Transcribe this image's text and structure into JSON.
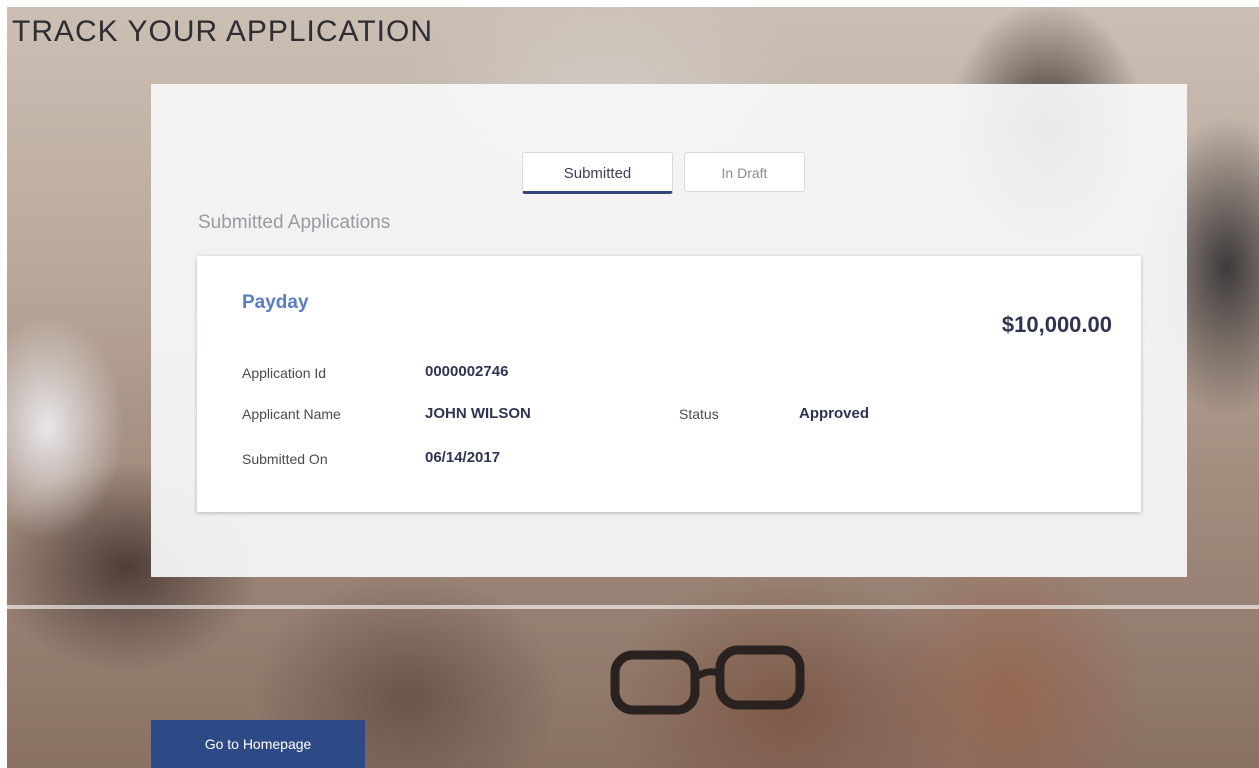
{
  "page": {
    "title": "TRACK YOUR APPLICATION"
  },
  "tabs": [
    {
      "label": "Submitted",
      "active": true
    },
    {
      "label": "In Draft",
      "active": false
    }
  ],
  "section": {
    "title": "Submitted Applications"
  },
  "application": {
    "product": "Payday",
    "amount": "$10,000.00",
    "fields": {
      "application_id_label": "Application Id",
      "application_id_value": "0000002746",
      "applicant_name_label": "Applicant Name",
      "applicant_name_value": "JOHN WILSON",
      "submitted_on_label": "Submitted On",
      "submitted_on_value": "06/14/2017",
      "status_label": "Status",
      "status_value": "Approved"
    }
  },
  "footer": {
    "home_button_label": "Go to Homepage"
  },
  "colors": {
    "accent": "#2e4a86",
    "product_link": "#5a7ec6",
    "text_dark": "#2f3450"
  }
}
